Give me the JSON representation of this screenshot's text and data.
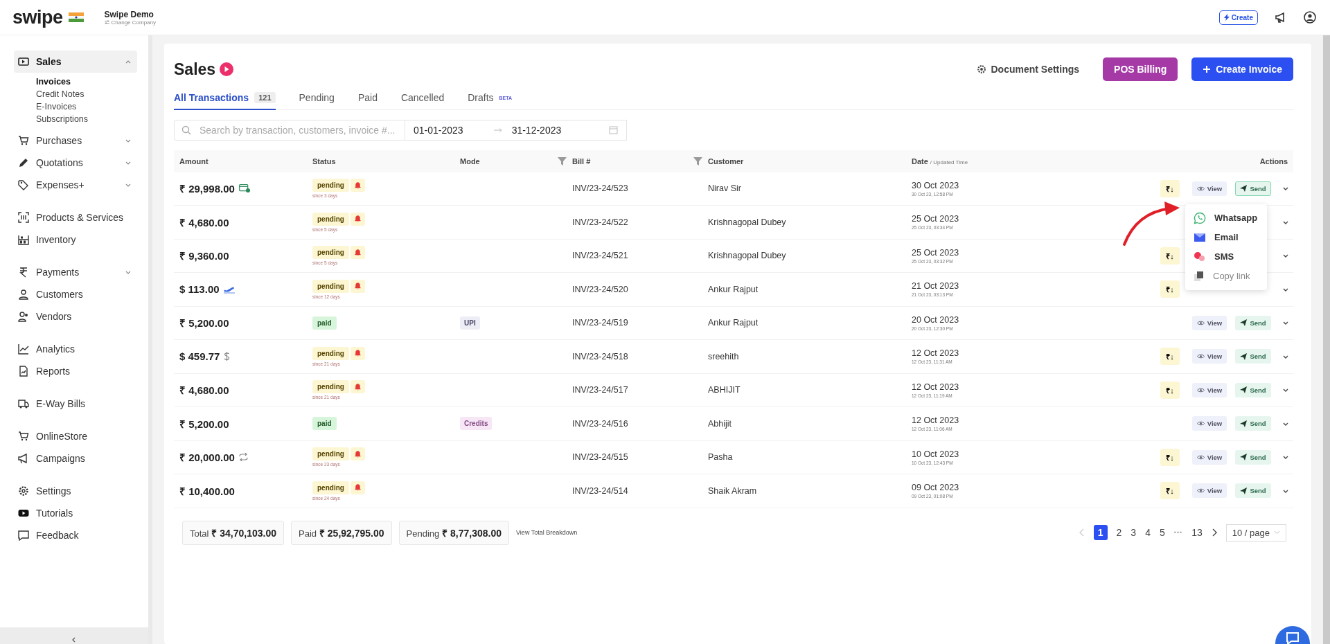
{
  "header": {
    "logo": "swipe",
    "company": "Swipe Demo",
    "change_company": "Change Company",
    "create_button": "Create"
  },
  "sidebar": {
    "groups": [
      [
        {
          "label": "Sales",
          "expanded": true,
          "selected": true,
          "children": [
            {
              "label": "Invoices",
              "selected": true
            },
            {
              "label": "Credit Notes",
              "selected": false
            },
            {
              "label": "E-Invoices",
              "selected": false
            },
            {
              "label": "Subscriptions",
              "selected": false
            }
          ]
        },
        {
          "label": "Purchases",
          "expanded": false,
          "selected": false
        },
        {
          "label": "Quotations",
          "expanded": false,
          "selected": false
        },
        {
          "label": "Expenses+",
          "expanded": false,
          "selected": false
        }
      ],
      [
        {
          "label": "Products & Services",
          "selected": false
        },
        {
          "label": "Inventory",
          "selected": false
        }
      ],
      [
        {
          "label": "Payments",
          "expanded": false,
          "selected": false
        },
        {
          "label": "Customers",
          "selected": false
        },
        {
          "label": "Vendors",
          "selected": false
        }
      ],
      [
        {
          "label": "Analytics",
          "selected": false
        },
        {
          "label": "Reports",
          "selected": false
        }
      ],
      [
        {
          "label": "E-Way Bills",
          "selected": false
        }
      ],
      [
        {
          "label": "OnlineStore",
          "selected": false
        },
        {
          "label": "Campaigns",
          "selected": false
        }
      ],
      [
        {
          "label": "Settings",
          "selected": false
        },
        {
          "label": "Tutorials",
          "selected": false
        },
        {
          "label": "Feedback",
          "selected": false
        }
      ]
    ]
  },
  "page": {
    "title": "Sales",
    "document_settings": "Document Settings",
    "pos_button": "POS Billing",
    "create_button": "Create Invoice"
  },
  "tabs": [
    {
      "label": "All Transactions",
      "count": "121",
      "selected": true
    },
    {
      "label": "Pending",
      "selected": false
    },
    {
      "label": "Paid",
      "selected": false
    },
    {
      "label": "Cancelled",
      "selected": false
    },
    {
      "label": "Drafts",
      "badge": "BETA",
      "selected": false
    }
  ],
  "filters": {
    "search_placeholder": "Search by transaction, customers, invoice #...",
    "date_from": "01-01-2023",
    "date_to": "31-12-2023"
  },
  "table": {
    "columns": [
      "Amount",
      "Status",
      "Mode",
      "Bill #",
      "Customer",
      "Date",
      "Actions"
    ],
    "date_sub": "/ Updated Time",
    "rows": [
      {
        "amount": "₹ 29,998.00",
        "status": "pending",
        "since": "since 3 days",
        "bill": "INV/23-24/523",
        "customer": "Nirav Sir",
        "date": "30 Oct 2023",
        "datetime": "30 Oct 23, 12:58 PM",
        "pay": "₹↓",
        "view": "View",
        "send": "Send",
        "send_selected": true
      },
      {
        "amount": "₹ 4,680.00",
        "status": "pending",
        "since": "since 5 days",
        "bill": "INV/23-24/522",
        "customer": "Krishnagopal Dubey",
        "date": "25 Oct 2023",
        "datetime": "25 Oct 23, 03:34 PM"
      },
      {
        "amount": "₹ 9,360.00",
        "status": "pending",
        "since": "since 5 days",
        "bill": "INV/23-24/521",
        "customer": "Krishnagopal Dubey",
        "date": "25 Oct 2023",
        "datetime": "25 Oct 23, 03:32 PM",
        "pay": "₹↓"
      },
      {
        "amount": "$ 113.00",
        "status": "pending",
        "since": "since 12 days",
        "bill": "INV/23-24/520",
        "customer": "Ankur Rajput",
        "date": "21 Oct 2023",
        "datetime": "21 Oct 23, 03:13 PM",
        "pay": "₹↓"
      },
      {
        "amount": "₹ 5,200.00",
        "status": "paid",
        "mode": "UPI",
        "bill": "INV/23-24/519",
        "customer": "Ankur Rajput",
        "date": "20 Oct 2023",
        "datetime": "20 Oct 23, 12:30 PM",
        "view": "View",
        "send": "Send",
        "send_selected": false
      },
      {
        "amount": "$ 459.77",
        "status": "pending",
        "since": "since 21 days",
        "bill": "INV/23-24/518",
        "customer": "sreehith",
        "date": "12 Oct 2023",
        "datetime": "12 Oct 23, 11:31 AM",
        "pay": "₹↓",
        "view": "View",
        "send": "Send",
        "send_selected": false
      },
      {
        "amount": "₹ 4,680.00",
        "status": "pending",
        "since": "since 21 days",
        "bill": "INV/23-24/517",
        "customer": "ABHIJIT",
        "date": "12 Oct 2023",
        "datetime": "12 Oct 23, 11:19 AM",
        "pay": "₹↓",
        "view": "View",
        "send": "Send",
        "send_selected": false
      },
      {
        "amount": "₹ 5,200.00",
        "status": "paid",
        "mode": "Credits",
        "bill": "INV/23-24/516",
        "customer": "Abhijit",
        "date": "12 Oct 2023",
        "datetime": "12 Oct 23, 11:06 AM",
        "view": "View",
        "send": "Send",
        "send_selected": false
      },
      {
        "amount": "₹ 20,000.00",
        "status": "pending",
        "since": "since 23 days",
        "bill": "INV/23-24/515",
        "customer": "Pasha",
        "date": "10 Oct 2023",
        "datetime": "10 Oct 23, 12:43 PM",
        "pay": "₹↓",
        "view": "View",
        "send": "Send",
        "send_selected": false
      },
      {
        "amount": "₹ 10,400.00",
        "status": "pending",
        "since": "since 24 days",
        "bill": "INV/23-24/514",
        "customer": "Shaik Akram",
        "date": "09 Oct 2023",
        "datetime": "09 Oct 23, 01:08 PM",
        "pay": "₹↓",
        "view": "View",
        "send": "Send",
        "send_selected": false
      }
    ]
  },
  "send_menu": [
    {
      "label": "Whatsapp",
      "disabled": false
    },
    {
      "label": "Email",
      "disabled": false
    },
    {
      "label": "SMS",
      "disabled": false
    },
    {
      "label": "Copy link",
      "disabled": true
    }
  ],
  "totals": [
    {
      "label": "Total",
      "value": "₹ 34,70,103.00"
    },
    {
      "label": "Paid",
      "value": "₹ 25,92,795.00"
    },
    {
      "label": "Pending",
      "value": "₹ 8,77,308.00"
    }
  ],
  "breakdown_link": "View Total Breakdown",
  "pagination": {
    "pages": [
      {
        "label": "1",
        "selected": true
      },
      {
        "label": "2",
        "selected": false
      },
      {
        "label": "3",
        "selected": false
      },
      {
        "label": "4",
        "selected": false
      },
      {
        "label": "5",
        "selected": false
      }
    ],
    "ellipsis": "•••",
    "last": "13",
    "page_size": "10 / page"
  }
}
